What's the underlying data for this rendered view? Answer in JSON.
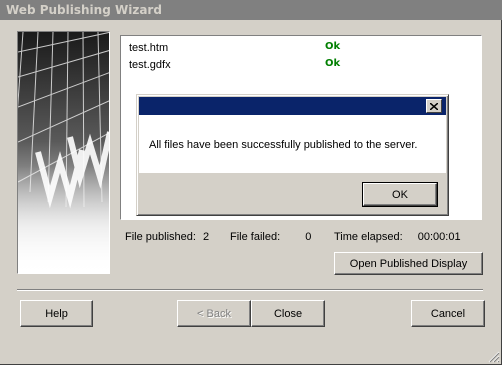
{
  "window": {
    "title": "Web Publishing Wizard"
  },
  "files": [
    {
      "name": "test.htm",
      "status": "Ok"
    },
    {
      "name": "test.gdfx",
      "status": "Ok"
    }
  ],
  "stats": {
    "published_label": "File published:",
    "published_value": "2",
    "failed_label": "File failed:",
    "failed_value": "0",
    "elapsed_label": "Time elapsed:",
    "elapsed_value": "00:00:01"
  },
  "buttons": {
    "open_published": "Open Published Display",
    "help": "Help",
    "back": "< Back",
    "close": "Close",
    "cancel": "Cancel"
  },
  "dialog": {
    "message": "All files have been successfully published to the server.",
    "ok": "OK"
  },
  "colors": {
    "title_bar_inactive": "#808080",
    "dialog_title_active": "#0a246a",
    "status_ok": "#007f00",
    "face": "#d4d0c8"
  }
}
